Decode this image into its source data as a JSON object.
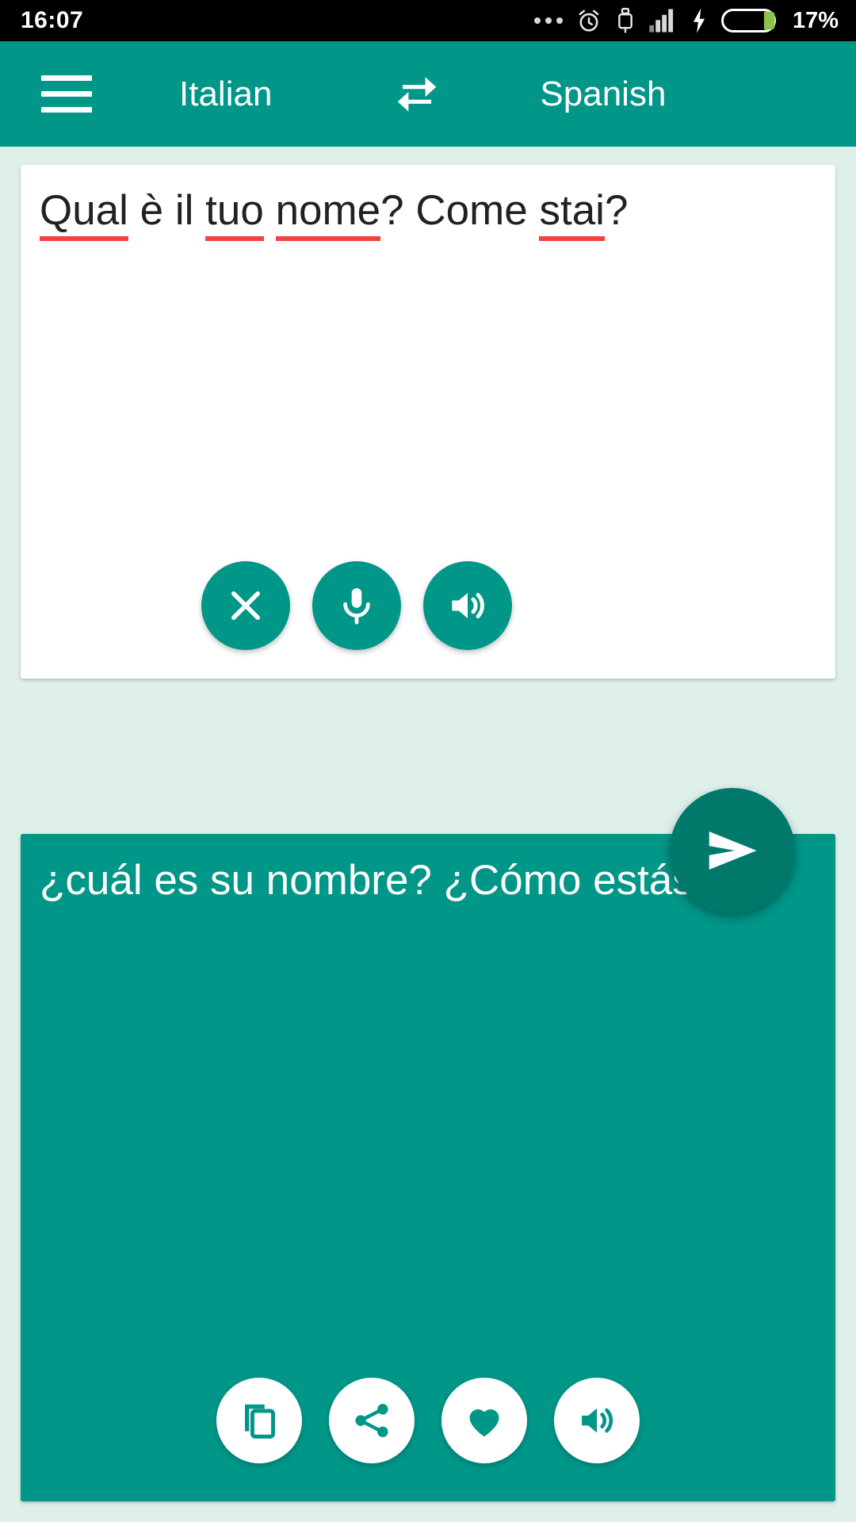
{
  "status_bar": {
    "time": "16:07",
    "battery_percent": "17%",
    "icons": [
      "more-ellipsis-icon",
      "alarm-clock-icon",
      "usb-icon",
      "signal-bars-icon",
      "charging-bolt-icon",
      "battery-icon"
    ]
  },
  "app_bar": {
    "menu_icon": "hamburger-menu-icon",
    "source_language": "Italian",
    "swap_icon": "swap-languages-icon",
    "target_language": "Spanish"
  },
  "input_card": {
    "text_segments": [
      {
        "text": "Qual",
        "misspelled": true
      },
      {
        "text": " è il ",
        "misspelled": false
      },
      {
        "text": "tuo",
        "misspelled": true
      },
      {
        "text": " ",
        "misspelled": false
      },
      {
        "text": "nome",
        "misspelled": true
      },
      {
        "text": "? Come ",
        "misspelled": false
      },
      {
        "text": "stai",
        "misspelled": true
      },
      {
        "text": "?",
        "misspelled": false
      }
    ],
    "full_text": "Qual è il tuo nome? Come stai?",
    "actions": [
      {
        "name": "clear-button",
        "icon": "close-x-icon"
      },
      {
        "name": "microphone-button",
        "icon": "microphone-icon"
      },
      {
        "name": "speak-source-button",
        "icon": "speaker-icon"
      }
    ]
  },
  "send_button": {
    "label": "",
    "icon": "send-icon"
  },
  "output_card": {
    "text": "¿cuál es su nombre? ¿Cómo estás?",
    "actions": [
      {
        "name": "copy-button",
        "icon": "copy-icon"
      },
      {
        "name": "share-button",
        "icon": "share-icon"
      },
      {
        "name": "favorite-button",
        "icon": "heart-icon"
      },
      {
        "name": "speak-translation-button",
        "icon": "speaker-icon"
      }
    ]
  },
  "colors": {
    "primary": "#009688",
    "primary_dark": "#00796b",
    "background": "#dff0eb",
    "spellcheck_underline": "#f0433f",
    "status_bar": "#000000",
    "battery_fill": "#8bc34a"
  }
}
